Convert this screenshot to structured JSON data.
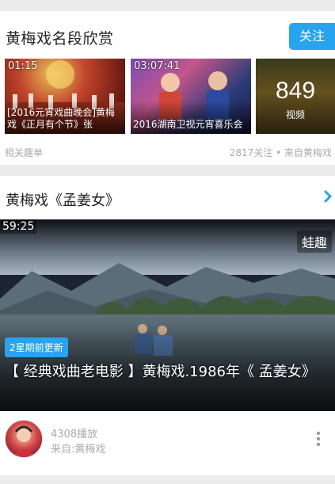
{
  "playlist_card": {
    "title": "黄梅戏名段欣赏",
    "follow_label": "关注",
    "thumbnails": [
      {
        "duration": "01:15",
        "caption": "[2016元宵戏曲晚会]黄梅戏《正月有个节》张"
      },
      {
        "duration": "03:07:41",
        "caption": "2016湖南卫视元宵喜乐会"
      }
    ],
    "count_tile": {
      "number": "849",
      "label": "视频"
    },
    "footer_left": "相关趣单",
    "footer_right": "2817关注 • 来自黄梅戏"
  },
  "video_card": {
    "title": "黄梅戏《孟姜女》",
    "chevron_icon": "chevron-right-icon",
    "duration": "59:25",
    "watermark": "蛙趣",
    "badge": "2星期前更新",
    "caption": "【 经典戏曲老电影 】黄梅戏.1986年《 孟姜女》",
    "play_count": "4308播放",
    "source": "来自:黄梅戏",
    "more_icon": "more-vertical-icon"
  },
  "colors": {
    "accent": "#27a3f0",
    "background": "#ececec",
    "muted_text": "#aaaaaa"
  }
}
